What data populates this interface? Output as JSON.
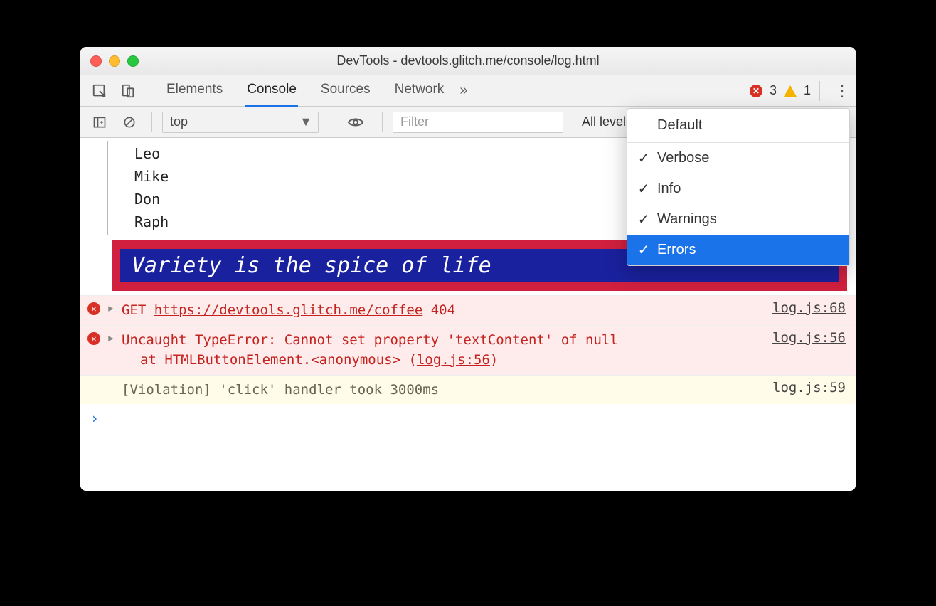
{
  "window": {
    "title": "DevTools - devtools.glitch.me/console/log.html"
  },
  "tabs": {
    "items": [
      "Elements",
      "Console",
      "Sources",
      "Network"
    ],
    "active_index": 1,
    "overflow_glyph": "»"
  },
  "badges": {
    "errors": "3",
    "warnings": "1"
  },
  "toolbar": {
    "context": "top",
    "filter_placeholder": "Filter",
    "levels_label": "All levels"
  },
  "dropdown": {
    "header": "Default",
    "items": [
      {
        "label": "Verbose",
        "checked": true,
        "selected": false
      },
      {
        "label": "Info",
        "checked": true,
        "selected": false
      },
      {
        "label": "Warnings",
        "checked": true,
        "selected": false
      },
      {
        "label": "Errors",
        "checked": true,
        "selected": true
      }
    ]
  },
  "tree": {
    "items": [
      "Leo",
      "Mike",
      "Don",
      "Raph"
    ]
  },
  "styled_log": "Variety is the spice of life",
  "logs": {
    "error1": {
      "method": "GET",
      "url": "https://devtools.glitch.me/coffee",
      "status": "404",
      "source": "log.js:68"
    },
    "error2": {
      "line1": "Uncaught TypeError: Cannot set property 'textContent' of null",
      "line2_prefix": "at HTMLButtonElement.<anonymous> (",
      "line2_link": "log.js:56",
      "line2_suffix": ")",
      "source": "log.js:56"
    },
    "violation": {
      "text": "[Violation] 'click' handler took 3000ms",
      "source": "log.js:59"
    }
  },
  "prompt_glyph": "›"
}
